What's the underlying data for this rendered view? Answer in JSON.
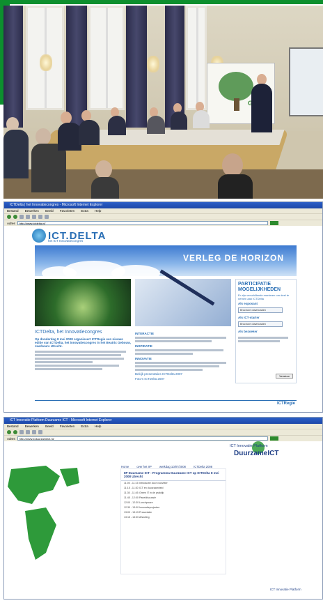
{
  "photo": {
    "banner_text": "Green"
  },
  "browser1": {
    "title": "ICTDelta | het Innovatiecongres - Microsoft Internet Explorer",
    "menu": [
      "Bestand",
      "Bewerken",
      "Beeld",
      "Favorieten",
      "Extra",
      "Help"
    ],
    "address_label": "Adres",
    "address": "http://www.ictdelta.nl/",
    "logo": "ICT.DELTA",
    "logo_sub": "het ICT Innovatiecongres",
    "hero_title": "VERLEG DE HORIZON",
    "left": {
      "heading": "ICTDelta, het Innovatiecongres",
      "intro": "Op donderdag 8 mei 2008 organiseert ICTRegie een nieuwe editie van ICTDelta, het innovatiecongres in het Beatrix Gebouw, Jaarbeurs Utrecht."
    },
    "mid": {
      "sections": [
        {
          "title": "INTERACTIE"
        },
        {
          "title": "INSPIRATIE"
        },
        {
          "title": "INNOVATIE"
        }
      ],
      "links": [
        "Bekijk presentaties ICTDelta 2007",
        "Foto's ICTDelta 2007"
      ]
    },
    "side": {
      "title": "PARTICIPATIE MOGELIJKHEDEN",
      "subtitle": "Er zijn verschillende manieren om deel te nemen aan ICTDelta",
      "options": [
        "Als exposant",
        "Als ICT-starter",
        "Als bezoeker"
      ],
      "select_label": "Brochure downloaden",
      "button": "Verstuur"
    },
    "footer": "ICTRegie"
  },
  "browser2": {
    "title": "ICT Innovatie Platform Duurzame ICT - Microsoft Internet Explorer",
    "menu": [
      "Bestand",
      "Bewerken",
      "Beeld",
      "Favorieten",
      "Extra",
      "Help"
    ],
    "address_label": "Adres",
    "address": "http://www.ipduurzameict.nl/",
    "logo_line1": "ICT Innovatie Platform",
    "logo_line2": "DuurzameICT",
    "nav": [
      "Home",
      "over het IIP",
      "werkdag 10/07/2008",
      "ICTDelta 2008"
    ],
    "panel_title": "IIP Duurzame ICT - Programma Duurzame ICT op ICTDelta 8 mei 2008 Utrecht",
    "program": [
      {
        "time": "11:00 - 11:15",
        "event": "Introductie door voorzitter"
      },
      {
        "time": "11:15 - 11:30",
        "event": "ICT en duurzaamheid"
      },
      {
        "time": "11:30 - 11:45",
        "event": "Green IT in de praktijk"
      },
      {
        "time": "11:45 - 12:00",
        "event": "Paneldiscussie"
      },
      {
        "time": "12:00 - 12:30",
        "event": "Lunchpauze"
      },
      {
        "time": "12:30 - 13:00",
        "event": "Innovatieprojecten"
      },
      {
        "time": "13:00 - 13:15",
        "event": "Presentatie"
      },
      {
        "time": "13:15 - 13:30",
        "event": "Afsluiting"
      }
    ],
    "bottom_logo": "ICT Innovatie Platform"
  }
}
